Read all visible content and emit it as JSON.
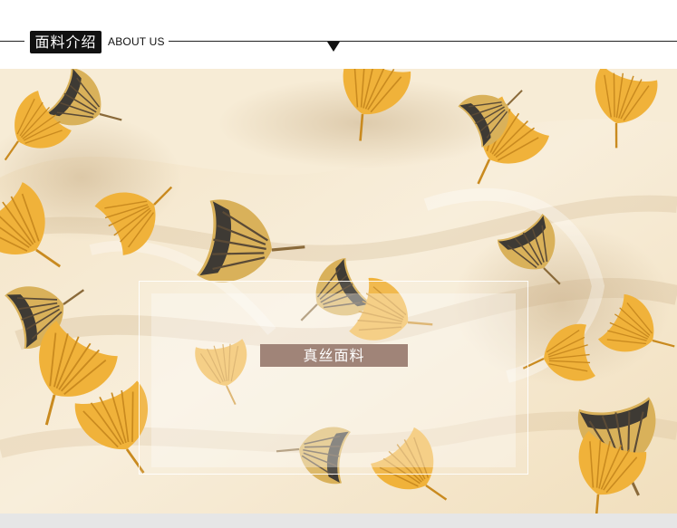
{
  "header": {
    "faded_text": "　　　　",
    "title_cn": "面料介绍",
    "title_en": "ABOUT US"
  },
  "photo": {
    "label": "真丝面料",
    "subject": "silk-scarf-ginkgo-print",
    "colors": {
      "fabric_base": "#f6ead2",
      "ginkgo_yellow": "#f0b23a",
      "ginkgo_dark": "#4a4036",
      "accent_label": "#a08478"
    }
  }
}
